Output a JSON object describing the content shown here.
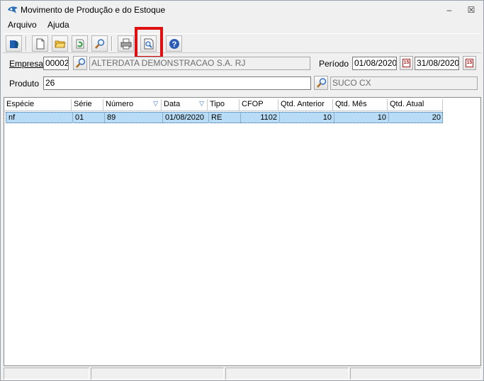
{
  "window": {
    "title": "Movimento de Produção e do Estoque",
    "minimize_glyph": "–",
    "close_glyph": "☒"
  },
  "menu": [
    {
      "label": "Arquivo"
    },
    {
      "label": "Ajuda"
    }
  ],
  "toolbar": {
    "buttons": [
      {
        "icon": "exit-icon"
      },
      {
        "icon": "new-document-icon"
      },
      {
        "icon": "open-folder-icon"
      },
      {
        "icon": "refresh-icon"
      },
      {
        "icon": "search-icon"
      },
      {
        "icon": "print-icon"
      },
      {
        "icon": "print-preview-icon"
      },
      {
        "icon": "help-icon"
      }
    ],
    "highlighted_button": "print-preview",
    "highlight_color": "#e01010"
  },
  "form": {
    "empresa_label": "Empresa",
    "empresa_code": "00002",
    "empresa_name": "ALTERDATA DEMONSTRACAO S.A. RJ",
    "periodo_label": "Período",
    "periodo_inicio": "01/08/2020",
    "periodo_fim": "31/08/2020",
    "calendar_glyph": "15",
    "produto_label": "Produto",
    "produto_code": "26",
    "produto_name": "SUCO CX"
  },
  "grid": {
    "columns": [
      {
        "label": "Espécie",
        "sortable": false
      },
      {
        "label": "Série",
        "sortable": false
      },
      {
        "label": "Número",
        "sortable": true
      },
      {
        "label": "Data",
        "sortable": true
      },
      {
        "label": "Tipo",
        "sortable": false
      },
      {
        "label": "CFOP",
        "sortable": false
      },
      {
        "label": "Qtd. Anterior",
        "sortable": false
      },
      {
        "label": "Qtd. Mês",
        "sortable": false
      },
      {
        "label": "Qtd. Atual",
        "sortable": false
      }
    ],
    "sort_glyph": "▽",
    "rows": [
      {
        "especie": "nf",
        "serie": "01",
        "numero": "89",
        "data": "01/08/2020",
        "tipo": "RE",
        "cfop": "1102",
        "qtd_anterior": "10",
        "qtd_mes": "10",
        "qtd_atual": "20"
      }
    ],
    "selected_row_color": "#b8dcf5"
  }
}
